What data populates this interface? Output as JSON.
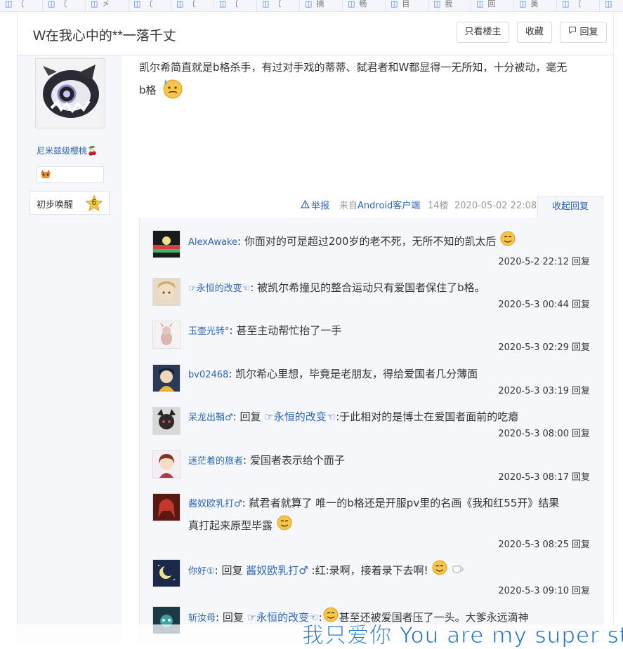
{
  "top_strip": {
    "cells": [
      {
        "glyph": "〔"
      },
      {
        "glyph": "〔"
      },
      {
        "glyph": "㐅"
      },
      {
        "glyph": "〔"
      },
      {
        "glyph": "〔"
      },
      {
        "glyph": "〔"
      },
      {
        "glyph": "〔"
      },
      {
        "glyph": "摘"
      },
      {
        "glyph": "畅"
      },
      {
        "glyph": "目"
      },
      {
        "glyph": "我"
      },
      {
        "glyph": "回"
      },
      {
        "glyph": "美"
      },
      {
        "glyph": "〔"
      },
      {
        "glyph": ""
      }
    ]
  },
  "thread": {
    "title": "W在我心中的**一落千丈",
    "buttons": {
      "only_op": "只看楼主",
      "favorite": "收藏",
      "reply": "回复"
    }
  },
  "author": {
    "name": "尼米兹级樱桃🍒",
    "level_name": "初步唤醒",
    "level_num": "6"
  },
  "post": {
    "text_part1": "凯尔希简直就是b格杀手，有过对手戏的蒂蒂、弑君者和W都显得一无所知，十分被动，毫无",
    "text_part2": "b格",
    "report": "举报",
    "client_prefix": "来自",
    "client": "Android客户端",
    "floor": "14楼",
    "time": "2020-05-02 22:08",
    "collapse": "收起回复"
  },
  "replies": [
    {
      "user": "AlexAwake",
      "sep": ":",
      "content": "你面对的可是超过200岁的老不死，无所不知的凯太后",
      "time": "2020-5-2 22:12",
      "reply_label": "回复",
      "emoji": true
    },
    {
      "user": "☞永恒的改变☜",
      "sep": ":",
      "content": "被凯尔希撞见的整合运动只有爱国者保住了b格。",
      "time": "2020-5-3 00:44",
      "reply_label": "回复"
    },
    {
      "user": "玉壶光转°",
      "sep": ":",
      "content": "甚至主动帮忙抬了一手",
      "time": "2020-5-3 02:29",
      "reply_label": "回复"
    },
    {
      "user": "bv02468",
      "sep": ":",
      "content": "凯尔希心里想，毕竟是老朋友，得给爱国者几分薄面",
      "time": "2020-5-3 03:19",
      "reply_label": "回复"
    },
    {
      "user": "呆龙出鞘♂",
      "sep": ":",
      "prefix": "回复",
      "target": "☞永恒的改变☜",
      "content": ":于此相对的是博士在爱国者面前的吃瘪",
      "time": "2020-5-3 08:00",
      "reply_label": "回复"
    },
    {
      "user": "迷茫着的旅者",
      "sep": ":",
      "content": "爱国者表示给个面子",
      "time": "2020-5-3 08:17",
      "reply_label": "回复"
    },
    {
      "user": "酱奴欧乳打♂",
      "sep": ":",
      "content": "弑君者就算了 唯一的b格还是开服pv里的名画《我和红55开》结果",
      "content2": "真打起来原型毕露",
      "time": "2020-5-3 08:25",
      "reply_label": "回复"
    },
    {
      "user": "你好①",
      "sep": ":",
      "prefix": "回复",
      "target": "酱奴欧乳打♂",
      "content": ":红:录啊，接着录下去啊!",
      "time": "2020-5-3 09:10",
      "reply_label": "回复"
    },
    {
      "user": "斩汝母",
      "sep": ":",
      "prefix": "回复",
      "target": "☞永恒的改变☜",
      "content": "甚至还被爱国者压了一头。大爹永远滴神",
      "time": "",
      "reply_label": ""
    }
  ],
  "overlay": {
    "text": "我只爱你 You are my super star"
  },
  "colors": {
    "link": "#2d64b3",
    "panel_bg": "#f5f7fa",
    "overlay": "#1a73c7"
  }
}
